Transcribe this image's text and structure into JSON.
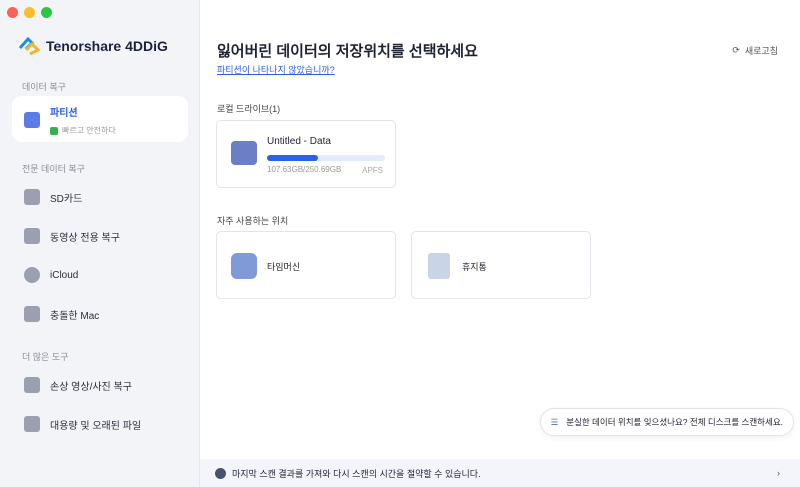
{
  "app": {
    "name": "Tenorshare 4DDiG"
  },
  "sidebar": {
    "section1": "데이터 복구",
    "partition": {
      "label": "파티션",
      "sub": "빠르고 안전하다"
    },
    "section2": "전문 데이터 복구",
    "items2": [
      {
        "label": "SD카드"
      },
      {
        "label": "동영상 전용 복구"
      },
      {
        "label": "iCloud"
      },
      {
        "label": "충돌한 Mac"
      }
    ],
    "section3": "더 많은 도구",
    "items3": [
      {
        "label": "손상 영상/사진 복구"
      },
      {
        "label": "대용량 및 오래된 파일"
      }
    ]
  },
  "main": {
    "title": "잃어버린 데이터의 저장위치를 선택하세요",
    "link": "파티션이 나타나지 않았습니까?",
    "refresh": "새로고침",
    "local_label": "로컬 드라이브(1)",
    "drive": {
      "name": "Untitled - Data",
      "size": "107.63GB/250.69GB",
      "fs": "APFS",
      "used_percent": 43
    },
    "common_label": "자주 사용하는 위치",
    "locations": [
      {
        "label": "타임머신"
      },
      {
        "label": "휴지통"
      }
    ],
    "tip": "분실한 데이터 위치를 잊으셨나요? 전체 디스크를 스캔하세요.",
    "bottom": "마지막 스캔 결과를 가져와 다시 스캔의 시간을 절약할 수 있습니다."
  }
}
